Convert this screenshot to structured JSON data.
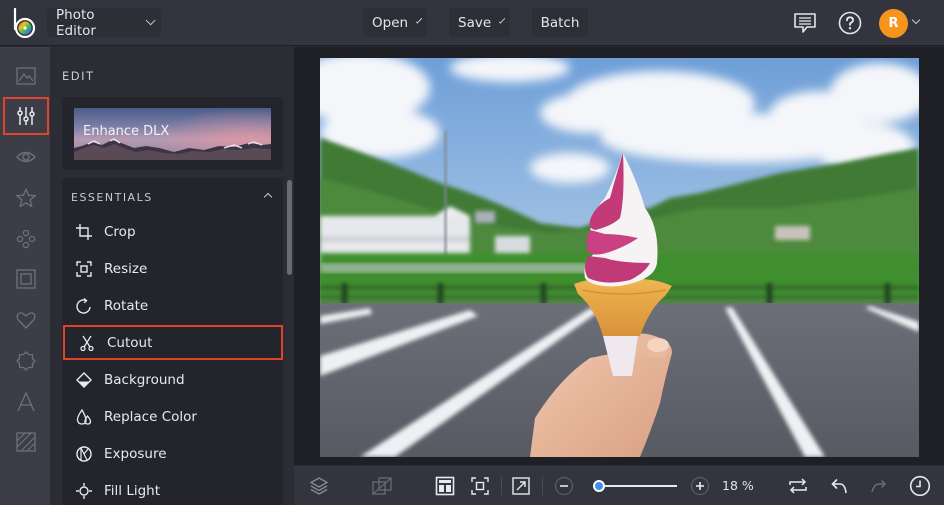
{
  "app": {
    "logo_icon": "befunky-b-logo",
    "mode_menu": "Photo Editor"
  },
  "topbar": {
    "open_label": "Open",
    "save_label": "Save",
    "batch_label": "Batch",
    "feedback_icon": "chat-icon",
    "help_icon": "help-icon",
    "avatar_initial": "R",
    "avatar_color": "#f7941d"
  },
  "rail": {
    "items": [
      {
        "name": "image-manager",
        "icon": "mountain-frame-icon",
        "active": false
      },
      {
        "name": "edit",
        "icon": "sliders-icon",
        "active": true
      },
      {
        "name": "touch-up",
        "icon": "eye-icon",
        "active": false
      },
      {
        "name": "effects",
        "icon": "star-icon",
        "active": false
      },
      {
        "name": "artsy",
        "icon": "circles-icon",
        "active": false
      },
      {
        "name": "frames",
        "icon": "frame-icon",
        "active": false
      },
      {
        "name": "graphics",
        "icon": "heart-icon",
        "active": false
      },
      {
        "name": "overlays",
        "icon": "badge-icon",
        "active": false
      },
      {
        "name": "text",
        "icon": "text-icon",
        "active": false
      },
      {
        "name": "textures",
        "icon": "texture-icon",
        "active": false
      }
    ],
    "active_color": "#e0422b"
  },
  "panel": {
    "title": "EDIT",
    "enhance_card_label": "Enhance DLX",
    "section_title": "ESSENTIALS",
    "tools": [
      {
        "label": "Crop",
        "icon": "crop-icon"
      },
      {
        "label": "Resize",
        "icon": "resize-icon"
      },
      {
        "label": "Rotate",
        "icon": "rotate-icon"
      },
      {
        "label": "Cutout",
        "icon": "scissors-icon",
        "highlighted": true
      },
      {
        "label": "Background",
        "icon": "background-icon"
      },
      {
        "label": "Replace Color",
        "icon": "droplets-icon"
      },
      {
        "label": "Exposure",
        "icon": "exposure-icon"
      },
      {
        "label": "Fill Light",
        "icon": "fill-light-icon"
      }
    ]
  },
  "canvas": {
    "photo_description": "Hand holding a pink and white swirl soft-serve ice cream cone over an empty parking lot, green hills and blue sky in background"
  },
  "bottombar": {
    "layers_icon": "layers-icon",
    "compare_icon": "compare-icon",
    "layout_icon": "layout-icon",
    "fit_icon": "fit-screen-icon",
    "fullscreen_icon": "expand-icon",
    "zoom_out_icon": "zoom-out-icon",
    "zoom_in_icon": "zoom-in-icon",
    "zoom_fraction": 0.06,
    "zoom_value": "18 %",
    "swap_icon": "swap-icon",
    "undo_icon": "undo-icon",
    "redo_icon": "redo-icon",
    "history_icon": "history-icon",
    "slider_color": "#3f8ef0"
  }
}
